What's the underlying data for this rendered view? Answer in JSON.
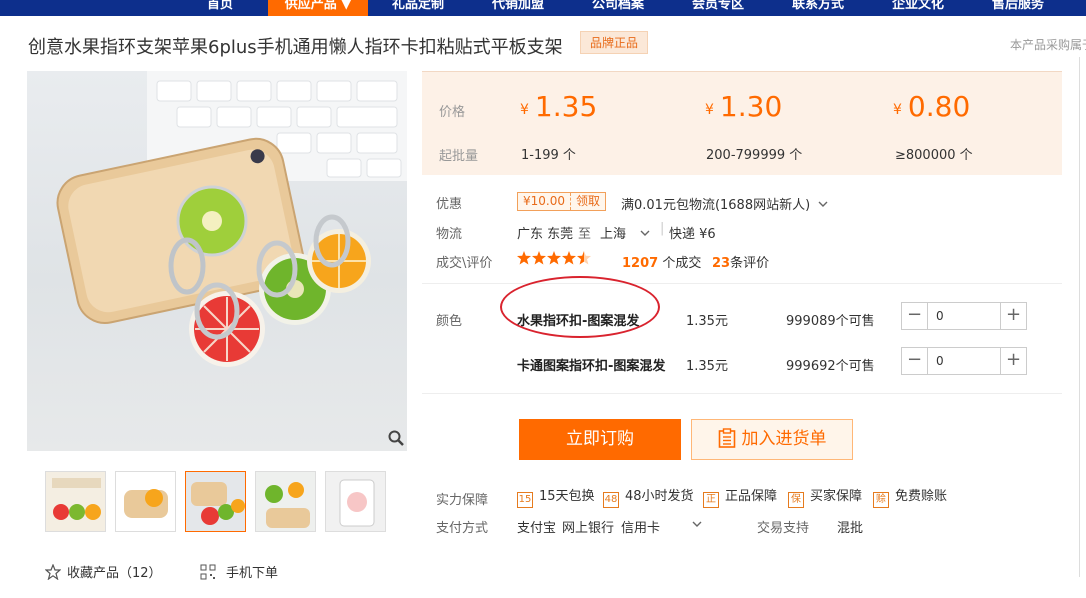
{
  "nav": {
    "items": [
      {
        "label": "首页"
      },
      {
        "label": "供应产品 ▼"
      },
      {
        "label": "礼品定制"
      },
      {
        "label": "代销加盟"
      },
      {
        "label": "公司档案"
      },
      {
        "label": "会员专区"
      },
      {
        "label": "联系方式"
      },
      {
        "label": "企业文化"
      },
      {
        "label": "售后服务"
      }
    ]
  },
  "product": {
    "title": "创意水果指环支架苹果6plus手机通用懒人指环卡扣粘贴式平板支架",
    "brand_badge": "品牌正品",
    "right_note": "本产品采购属于"
  },
  "price_box": {
    "price_label": "价格",
    "moq_label": "起批量",
    "currency": "¥",
    "tiers": [
      {
        "price": "1.35",
        "range": "1-199 个"
      },
      {
        "price": "1.30",
        "range": "200-799999 个"
      },
      {
        "price": "0.80",
        "range": "≥800000 个"
      }
    ]
  },
  "promo": {
    "label": "优惠",
    "coupon_value": "¥10.00",
    "coupon_action": "领取",
    "shipping_promo": "满0.01元包物流(1688网站新人)"
  },
  "logistics": {
    "label": "物流",
    "from": "广东 东莞",
    "to_word": "至",
    "to": "上海",
    "method": "快递 ¥6"
  },
  "deals": {
    "label": "成交\\评价",
    "rating": 4.5,
    "deal_count": "1207",
    "deal_suffix": "个成交",
    "review_count": "23",
    "review_suffix": "条评价"
  },
  "variants": {
    "label": "颜色",
    "items": [
      {
        "name": "水果指环扣-图案混发",
        "price": "1.35元",
        "stock": "999089个可售",
        "qty": "0"
      },
      {
        "name": "卡通图案指环扣-图案混发",
        "price": "1.35元",
        "stock": "999692个可售",
        "qty": "0"
      }
    ]
  },
  "actions": {
    "buy_now": "立即订购",
    "add_to_cart": "加入进货单"
  },
  "guarantees": {
    "label": "实力保障",
    "items": [
      {
        "icon": "15-days-icon",
        "glyph": "15",
        "text": "15天包换"
      },
      {
        "icon": "48-hours-icon",
        "glyph": "48",
        "text": "48小时发货"
      },
      {
        "icon": "genuine-icon",
        "glyph": "正",
        "text": "正品保障"
      },
      {
        "icon": "buyer-protection-icon",
        "glyph": "保",
        "text": "买家保障"
      },
      {
        "icon": "free-credit-icon",
        "glyph": "赊",
        "text": "免费赊账"
      }
    ]
  },
  "payment": {
    "label": "支付方式",
    "methods": [
      "支付宝",
      "网上银行",
      "信用卡"
    ],
    "trade_support_label": "交易支持",
    "trade_support_value": "混批"
  },
  "footer_links": {
    "favorite": "收藏产品（12）",
    "mobile_order": "手机下单"
  },
  "colors": {
    "nav_bg": "#0d2f8c",
    "accent": "#ff6a00",
    "price_box_bg": "#fdf1e7",
    "annotation_red": "#d9232e"
  }
}
